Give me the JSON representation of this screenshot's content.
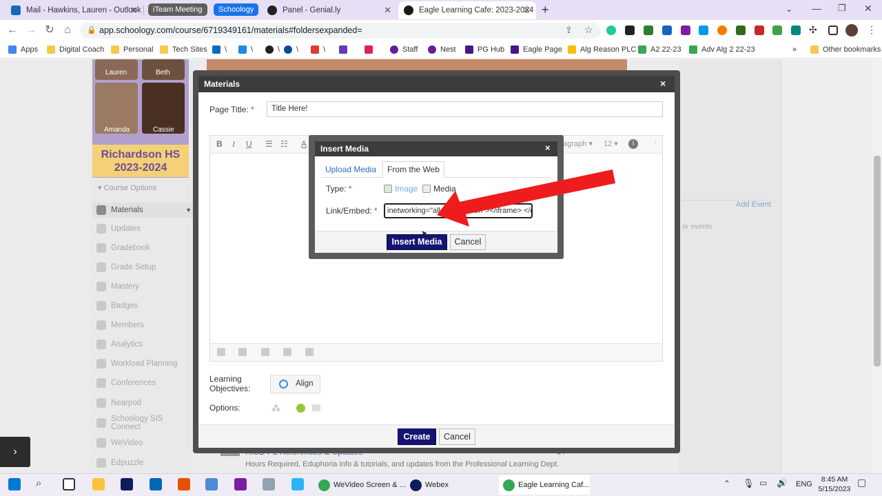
{
  "browser": {
    "tabs": [
      {
        "title": "Mail - Hawkins, Lauren - Outlook",
        "favicon_color": "#0f6cbd"
      },
      {
        "title": "Panel - Genial.ly",
        "favicon_color": "#222222"
      },
      {
        "title": "Eagle Learning Cafe: 2023-2024",
        "favicon_color": "#1a1a1a",
        "active": true
      }
    ],
    "tab_groups": [
      {
        "label": "iTeam Meeting",
        "color": "#5f5f5f"
      },
      {
        "label": "Schoology",
        "color": "#1a73e8"
      }
    ],
    "url": "app.schoology.com/course/6719349161/materials#foldersexpanded=",
    "bookmarks": [
      "Apps",
      "Digital Coach",
      "Personal",
      "Tech Sites",
      "\\",
      "\\",
      "\\",
      "\\",
      "\\",
      "Staff",
      "Nest",
      "PG Hub",
      "Eagle Page",
      "Alg Reason PLC",
      "A2 22-23",
      "Adv Alg 2 22-23",
      "Other bookmarks"
    ],
    "bookmarks_overflow": "»"
  },
  "course": {
    "banner_names": [
      "Lauren",
      "Beth",
      "Amanda",
      "Cassie"
    ],
    "banner_title": "Richardson HS 2023-2024",
    "course_options": "Course Options",
    "nav": [
      "Materials",
      "Updates",
      "Gradebook",
      "Grade Setup",
      "Mastery",
      "Badges",
      "Members",
      "Analytics",
      "Workload Planning",
      "Conferences",
      "Nearpod",
      "Schoology SIS Connect",
      "WeVideo",
      "Edpuzzle"
    ],
    "right_links": {
      "add_event": "Add Event",
      "events_text": "or events"
    },
    "bg_folder_title": "RISD PL References & Updates",
    "bg_folder_desc": "Hours Required, Eduphoria info & tutorials, and updates from the Professional Learning Dept."
  },
  "materials_modal": {
    "title": "Materials",
    "close": "×",
    "page_title_label": "Page Title:",
    "required_mark": "*",
    "page_title_value": "Title Here!",
    "toolbar": {
      "bold": "B",
      "italic": "I",
      "underline": "U",
      "format": "agraph",
      "size": "12"
    },
    "learning_objectives_label": "Learning Objectives:",
    "align_label": "Align",
    "options_label": "Options:",
    "create_label": "Create",
    "cancel_label": "Cancel"
  },
  "insert_media": {
    "title": "Insert Media",
    "close": "×",
    "tabs": [
      "Upload Media",
      "From the Web"
    ],
    "type_label": "Type:",
    "type_options": [
      "Image",
      "Media"
    ],
    "link_label": "Link/Embed:",
    "link_value": "inetworking=\"allowfullscreen\"></iframe> </div> </div>",
    "insert_label": "Insert Media",
    "cancel_label": "Cancel"
  },
  "taskbar": {
    "apps": [
      "WeVideo Screen & ...",
      "Webex",
      "Eagle Learning Caf..."
    ],
    "lang": "ENG",
    "time": "8:45 AM",
    "date": "5/15/2023"
  },
  "colors": {
    "annotation_arrow": "#ee1c1c",
    "primary_button": "#141473",
    "link": "#2f6cbf"
  }
}
